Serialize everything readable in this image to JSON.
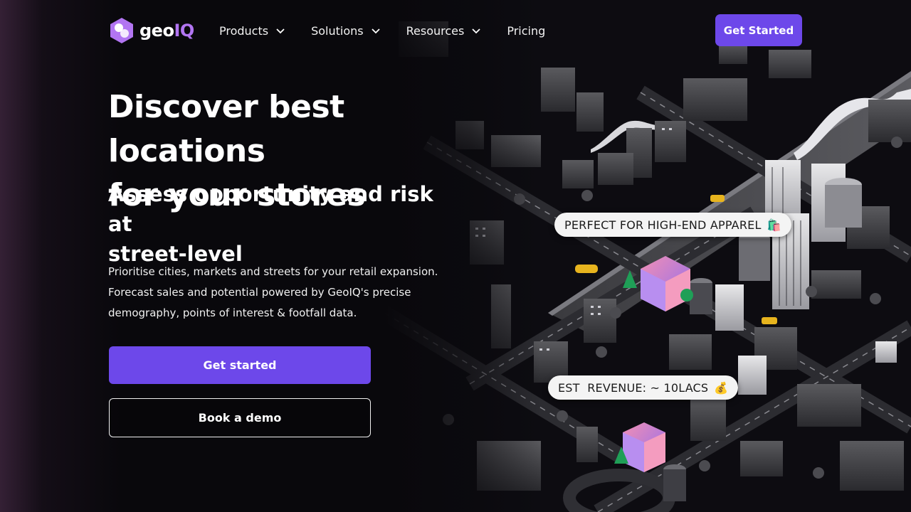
{
  "brand": {
    "name_part1": "geo",
    "name_part2": "IQ",
    "accent_color": "#6d48ea",
    "logo_color": "#b275f2"
  },
  "nav": {
    "items": [
      {
        "label": "Products",
        "has_dropdown": true
      },
      {
        "label": "Solutions",
        "has_dropdown": true
      },
      {
        "label": "Resources",
        "has_dropdown": true
      },
      {
        "label": "Pricing",
        "has_dropdown": false
      }
    ],
    "cta_label": "Get Started"
  },
  "hero": {
    "title_line1": "Discover best locations",
    "title_line2": "for your stores",
    "subtitle_line1": "Assess opportunity and risk at",
    "subtitle_line2": "street-level",
    "desc_line1": "Prioritise cities, markets and streets for your retail expansion.",
    "desc_line2": "Forecast sales and potential powered by GeoIQ's precise",
    "desc_line3": "demography, points of interest & footfall data.",
    "primary_cta": "Get started",
    "secondary_cta": "Book a demo"
  },
  "map_tags": {
    "tag1": {
      "text": "PERFECT FOR HIGH-END APPAREL",
      "icon": "shopping-bags-icon",
      "emoji": "🛍️"
    },
    "tag2": {
      "text": "EST  REVENUE: ~ 10LACS",
      "icon": "money-bag-icon",
      "emoji": "💰"
    }
  }
}
